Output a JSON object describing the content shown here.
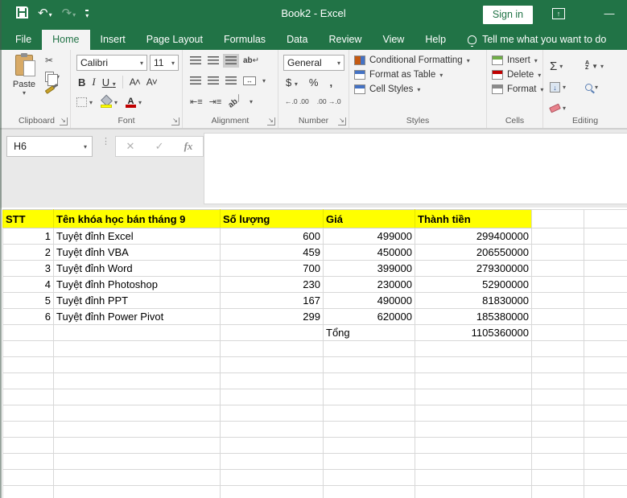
{
  "window": {
    "title": "Book2  -  Excel",
    "sign_in_label": "Sign in",
    "quick_access": [
      "save",
      "undo",
      "redo",
      "customize-quick-access"
    ]
  },
  "tabs": {
    "items": [
      {
        "label": "File"
      },
      {
        "label": "Home"
      },
      {
        "label": "Insert"
      },
      {
        "label": "Page Layout"
      },
      {
        "label": "Formulas"
      },
      {
        "label": "Data"
      },
      {
        "label": "Review"
      },
      {
        "label": "View"
      },
      {
        "label": "Help"
      }
    ],
    "active": "Home",
    "tell_me": "Tell me what you want to do"
  },
  "ribbon": {
    "groups": [
      {
        "label": "Clipboard"
      },
      {
        "label": "Font"
      },
      {
        "label": "Alignment"
      },
      {
        "label": "Number"
      },
      {
        "label": "Styles"
      },
      {
        "label": "Cells"
      },
      {
        "label": "Editing"
      }
    ],
    "paste": "Paste",
    "font_name": "Calibri",
    "font_size": "11",
    "bold": "B",
    "italic": "I",
    "underline": "U",
    "grow_font": "A",
    "shrink_font": "A",
    "wrap_text": "ab",
    "orientation": "ab",
    "number_format": "General",
    "currency": "$",
    "percent": "%",
    "comma": ",",
    "increase_decimal": "←.0 .00",
    "decrease_decimal": ".00 →.0",
    "conditional_formatting": "Conditional Formatting",
    "format_as_table": "Format as Table",
    "cell_styles": "Cell Styles",
    "insert": "Insert",
    "delete": "Delete",
    "format": "Format",
    "autosum": "Σ",
    "sort_a": "A",
    "sort_z": "Z"
  },
  "formula_bar": {
    "name_box": "H6",
    "fx_label": "fx",
    "cancel": "✕",
    "enter": "✓"
  },
  "sheet": {
    "columns": [
      "STT",
      "Tên khóa học bán tháng 9",
      "Số lượng",
      "Giá",
      "Thành tiền",
      "",
      ""
    ],
    "rows": [
      {
        "stt": "1",
        "name": "Tuyệt đỉnh Excel",
        "qty": "600",
        "price": "499000",
        "total": "299400000"
      },
      {
        "stt": "2",
        "name": "Tuyệt đỉnh VBA",
        "qty": "459",
        "price": "450000",
        "total": "206550000"
      },
      {
        "stt": "3",
        "name": "Tuyệt đỉnh Word",
        "qty": "700",
        "price": "399000",
        "total": "279300000"
      },
      {
        "stt": "4",
        "name": "Tuyệt đỉnh Photoshop",
        "qty": "230",
        "price": "230000",
        "total": "52900000"
      },
      {
        "stt": "5",
        "name": "Tuyệt đỉnh PPT",
        "qty": "167",
        "price": "490000",
        "total": "81830000"
      },
      {
        "stt": "6",
        "name": "Tuyệt đỉnh Power Pivot",
        "qty": "299",
        "price": "620000",
        "total": "185380000"
      }
    ],
    "total_label": "Tổng",
    "grand_total": "1105360000",
    "empty_rows": 10
  },
  "colors": {
    "excel_green": "#217346",
    "header_fill": "#ffff00",
    "fill_color_swatch": "#ffff00",
    "font_color_swatch": "#c00000",
    "ribbon_bg": "#f3f3f3",
    "gridline": "#d8d8d8"
  }
}
